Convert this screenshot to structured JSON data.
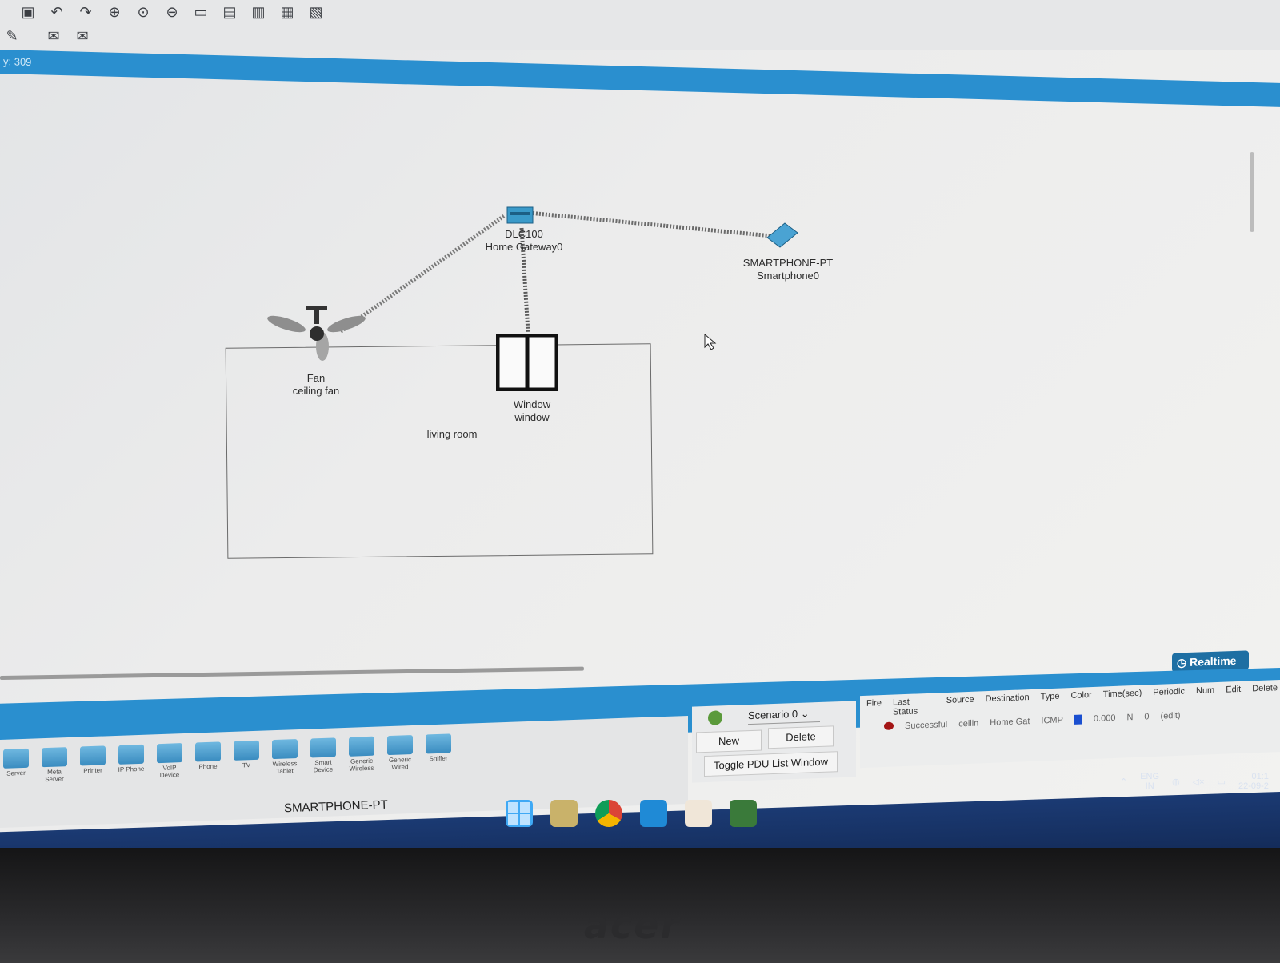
{
  "toolbar": {
    "icons_row1": [
      "save-icon",
      "undo-icon",
      "redo-icon",
      "zoom-in-icon",
      "zoom-reset-icon",
      "zoom-out-icon",
      "drawing-palette-icon",
      "custom-device-icon",
      "workspace-list-icon",
      "viewport-icon",
      "screenshot-icon"
    ],
    "icons_row2": [
      "pen-icon",
      "email-icon",
      "email-open-icon"
    ]
  },
  "title_bar": {
    "text": "y: 309"
  },
  "canvas": {
    "gateway": {
      "line1": "DLC100",
      "line2": "Home Gateway0"
    },
    "smartphone": {
      "line1": "SMARTPHONE-PT",
      "line2": "Smartphone0"
    },
    "fan": {
      "line1": "Fan",
      "line2": "ceiling fan"
    },
    "window": {
      "line1": "Window",
      "line2": "window"
    },
    "room_label": "living room"
  },
  "mode": {
    "realtime_label": "Realtime"
  },
  "palette": {
    "items": [
      "Server",
      "Meta Server",
      "Printer",
      "IP Phone",
      "VoIP Device",
      "Phone",
      "TV",
      "Wireless Tablet",
      "Smart Device",
      "Generic Wireless",
      "Generic Wired",
      "Sniffer"
    ],
    "selected_device": "SMARTPHONE-PT"
  },
  "scenario": {
    "selected": "Scenario 0",
    "new_label": "New",
    "delete_label": "Delete",
    "toggle_label": "Toggle PDU List Window"
  },
  "pdu": {
    "headers": [
      "Fire",
      "Last Status",
      "Source",
      "Destination",
      "Type",
      "Color",
      "Time(sec)",
      "Periodic",
      "Num",
      "Edit",
      "Delete"
    ],
    "row": {
      "status": "Successful",
      "source": "ceilin",
      "destination": "Home Gat",
      "type": "ICMP",
      "color": "#1a4fd0",
      "time": "0.000",
      "periodic": "N",
      "num": "0",
      "edit": "(edit)"
    }
  },
  "tray": {
    "lang1": "ENG",
    "lang2": "IN",
    "time": "01:1",
    "date": "22-09-2"
  },
  "brand": "acer",
  "colors": {
    "accent": "#2a8fcf",
    "status_success": "#a31515"
  }
}
